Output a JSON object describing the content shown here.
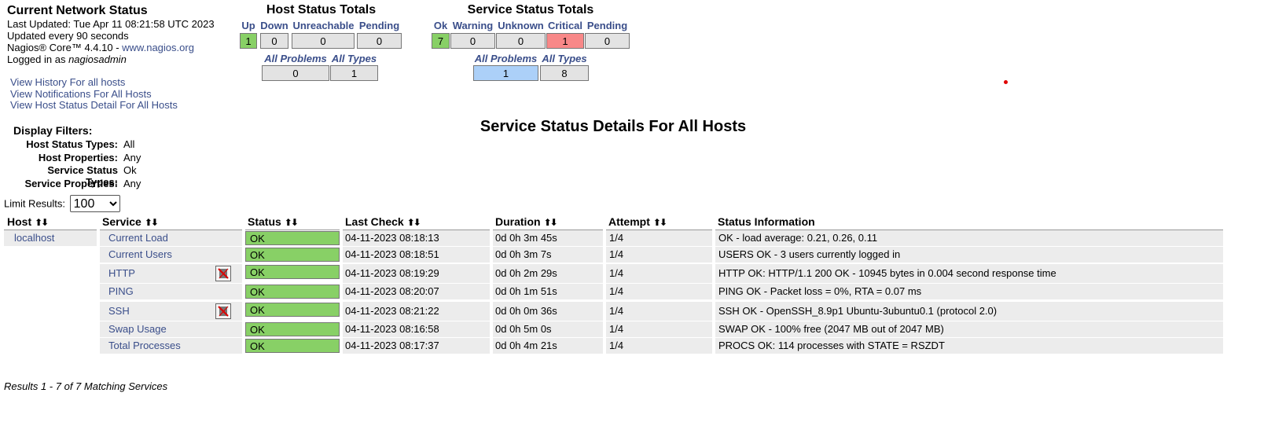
{
  "info": {
    "title": "Current Network Status",
    "last_updated": "Last Updated: Tue Apr 11 08:21:58 UTC 2023",
    "update_interval": "Updated every 90 seconds",
    "version_prefix": "Nagios® Core™ 4.4.10 - ",
    "version_link": "www.nagios.org",
    "logged_in_prefix": "Logged in as ",
    "user": "nagiosadmin"
  },
  "host_totals": {
    "title": "Host Status Totals",
    "headers": [
      "Up",
      "Down",
      "Unreachable",
      "Pending"
    ],
    "values": [
      "1",
      "0",
      "0",
      "0"
    ],
    "problem_headers": [
      "All Problems",
      "All Types"
    ],
    "problem_values": [
      "0",
      "1"
    ]
  },
  "service_totals": {
    "title": "Service Status Totals",
    "headers": [
      "Ok",
      "Warning",
      "Unknown",
      "Critical",
      "Pending"
    ],
    "values": [
      "7",
      "0",
      "0",
      "1",
      "0"
    ],
    "problem_headers": [
      "All Problems",
      "All Types"
    ],
    "problem_values": [
      "1",
      "8"
    ]
  },
  "links": [
    "View History For all hosts",
    "View Notifications For All Hosts",
    "View Host Status Detail For All Hosts"
  ],
  "filters": {
    "title": "Display Filters:",
    "rows": [
      {
        "label": "Host Status Types:",
        "value": "All"
      },
      {
        "label": "Host Properties:",
        "value": "Any"
      },
      {
        "label": "Service Status Types:",
        "value": "Ok"
      },
      {
        "label": "Service Properties:",
        "value": "Any"
      }
    ]
  },
  "page_title": "Service Status Details For All Hosts",
  "limit": {
    "label": "Limit Results:",
    "value": "100"
  },
  "table": {
    "headers": [
      "Host",
      "Service",
      "Status",
      "Last Check",
      "Duration",
      "Attempt",
      "Status Information"
    ],
    "host": "localhost",
    "rows": [
      {
        "service": "Current Load",
        "status": "OK",
        "last_check": "04-11-2023 08:18:13",
        "duration": "0d 0h 3m 45s",
        "attempt": "1/4",
        "info": "OK - load average: 0.21, 0.26, 0.11"
      },
      {
        "service": "Current Users",
        "status": "OK",
        "last_check": "04-11-2023 08:18:51",
        "duration": "0d 0h 3m 7s",
        "attempt": "1/4",
        "info": "USERS OK - 3 users currently logged in"
      },
      {
        "service": "HTTP",
        "status": "OK",
        "last_check": "04-11-2023 08:19:29",
        "duration": "0d 0h 2m 29s",
        "attempt": "1/4",
        "info": "HTTP OK: HTTP/1.1 200 OK - 10945 bytes in 0.004 second response time"
      },
      {
        "service": "PING",
        "status": "OK",
        "last_check": "04-11-2023 08:20:07",
        "duration": "0d 0h 1m 51s",
        "attempt": "1/4",
        "info": "PING OK - Packet loss = 0%, RTA = 0.07 ms"
      },
      {
        "service": "SSH",
        "status": "OK",
        "last_check": "04-11-2023 08:21:22",
        "duration": "0d 0h 0m 36s",
        "attempt": "1/4",
        "info": "SSH OK - OpenSSH_8.9p1 Ubuntu-3ubuntu0.1 (protocol 2.0)"
      },
      {
        "service": "Swap Usage",
        "status": "OK",
        "last_check": "04-11-2023 08:16:58",
        "duration": "0d 0h 5m 0s",
        "attempt": "1/4",
        "info": "SWAP OK - 100% free (2047 MB out of 2047 MB)"
      },
      {
        "service": "Total Processes",
        "status": "OK",
        "last_check": "04-11-2023 08:17:37",
        "duration": "0d 0h 4m 21s",
        "attempt": "1/4",
        "info": "PROCS OK: 114 processes with STATE = RSZDT"
      }
    ]
  },
  "results_text": "Results 1 - 7 of 7 Matching Services",
  "colors": {
    "ok": "#88d066",
    "critical": "#f88888",
    "selected": "#acd0f8",
    "neutral": "#e3e3e3",
    "link": "#3a4e8a"
  }
}
